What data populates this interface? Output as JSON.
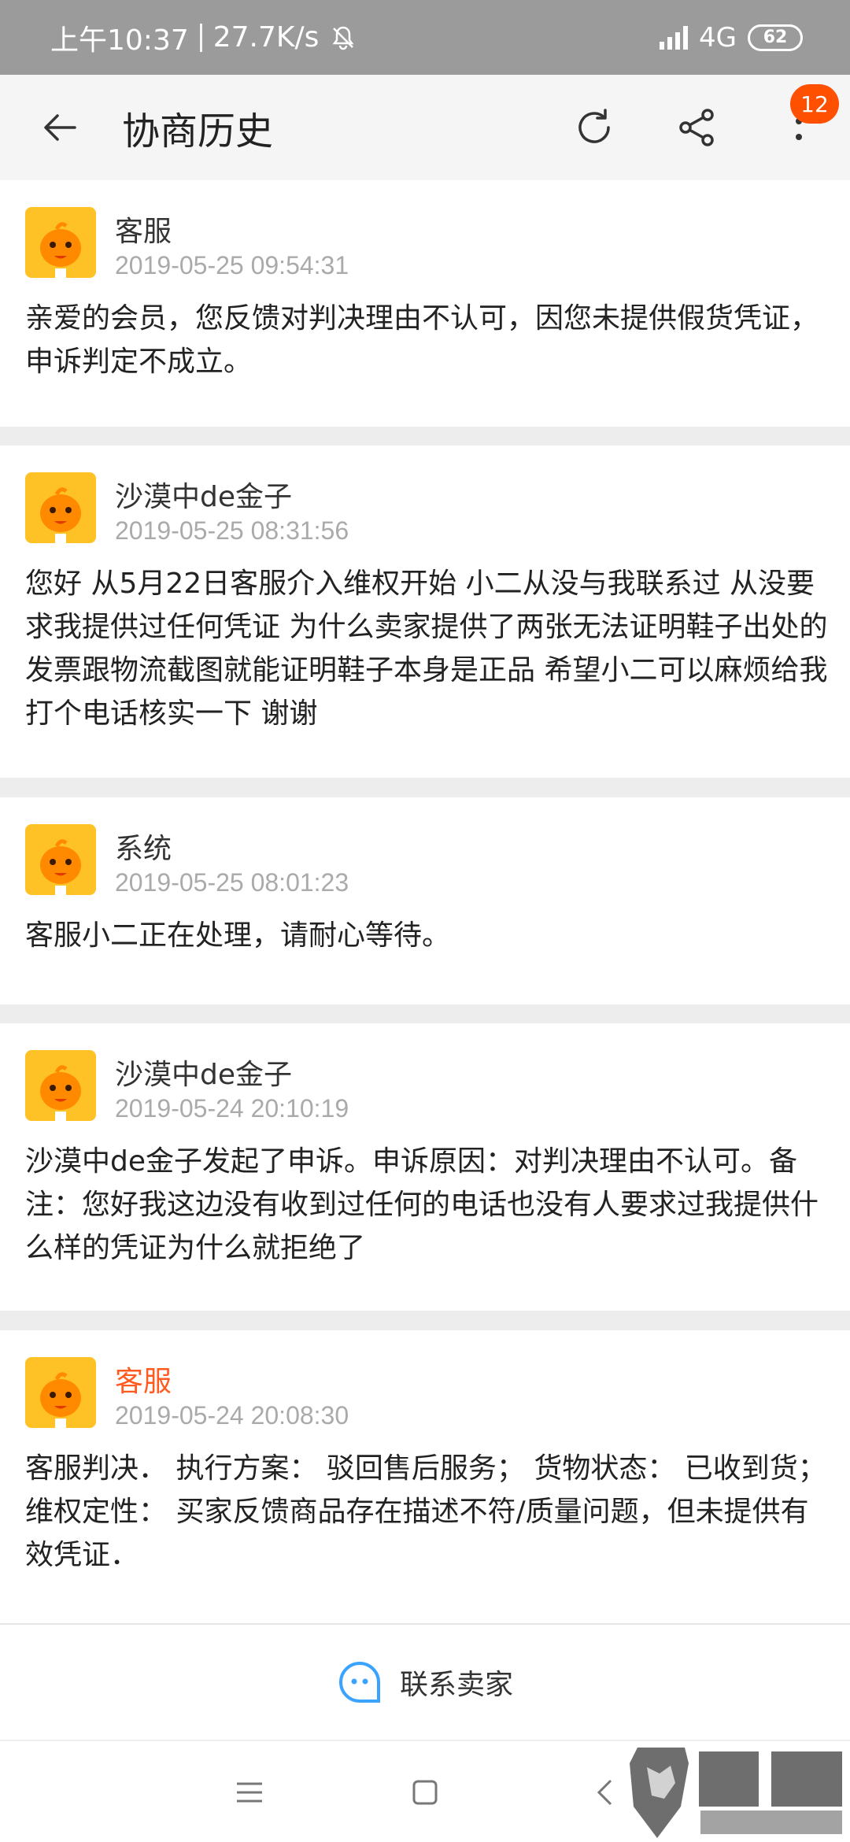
{
  "status": {
    "time": "上午10:37",
    "speed": "27.7K/s",
    "network": "4G",
    "battery": "62"
  },
  "app_bar": {
    "title": "协商历史",
    "badge": "12",
    "icons": [
      "back-arrow-icon",
      "refresh-icon",
      "share-icon",
      "more-icon"
    ]
  },
  "messages": [
    {
      "sender": "客服",
      "time": "2019-05-25 09:54:31",
      "text": "亲爱的会员，您反馈对判决理由不认可，因您未提供假货凭证，申诉判定不成立。"
    },
    {
      "sender": "沙漠中de金子",
      "time": "2019-05-25 08:31:56",
      "text": "您好  从5月22日客服介入维权开始  小二从没与我联系过  从没要求我提供过任何凭证  为什么卖家提供了两张无法证明鞋子出处的发票跟物流截图就能证明鞋子本身是正品  希望小二可以麻烦给我打个电话核实一下  谢谢"
    },
    {
      "sender": "系统",
      "time": "2019-05-25 08:01:23",
      "text": "客服小二正在处理，请耐心等待。"
    },
    {
      "sender": "沙漠中de金子",
      "time": "2019-05-24 20:10:19",
      "text": "沙漠中de金子发起了申诉。申诉原因：对判决理由不认可。备注：您好我这边没有收到过任何的电话也没有人要求过我提供什么样的凭证为什么就拒绝了"
    },
    {
      "sender": "客服",
      "time": "2019-05-24 20:08:30",
      "text": "客服判决． 执行方案： 驳回售后服务； 货物状态： 已收到货； 维权定性： 买家反馈商品存在描述不符/质量问题，但未提供有效凭证．"
    }
  ],
  "contact": {
    "label": "联系卖家"
  },
  "colors": {
    "accent": "#ff5000",
    "highlight_sender": "#ff5a1f"
  }
}
